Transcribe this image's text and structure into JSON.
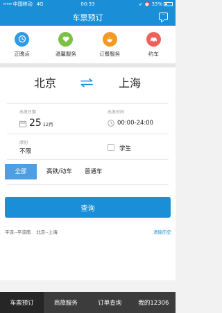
{
  "status": {
    "signal_dots": "•••••",
    "carrier": "中国移动",
    "network": "4G",
    "time": "00:33",
    "battery": "33%"
  },
  "nav": {
    "title": "车票预订"
  },
  "services": [
    {
      "label": "正晚点",
      "color": "#2d9be8",
      "icon": "clock-icon"
    },
    {
      "label": "温馨服务",
      "color": "#7cc242",
      "icon": "heart-icon"
    },
    {
      "label": "订餐服务",
      "color": "#f29a25",
      "icon": "meal-icon"
    },
    {
      "label": "约车",
      "color": "#f0605a",
      "icon": "car-icon"
    }
  ],
  "cities": {
    "from": "北京",
    "to": "上海"
  },
  "date": {
    "label": "出发日期",
    "day": "25",
    "month": "12月"
  },
  "time": {
    "label": "出发时间",
    "value": "00:00-24:00"
  },
  "seat": {
    "label": "席别",
    "value": "不限"
  },
  "student": {
    "label": "学生"
  },
  "tabs": [
    "全部",
    "高铁/动车",
    "普通车"
  ],
  "query": {
    "label": "查询"
  },
  "history": {
    "items": [
      "平凉--平凉南",
      "北京--上海"
    ],
    "clear": "清除历史"
  },
  "bottom_tabs": [
    "车票预订",
    "商旅服务",
    "订单查询",
    "我的12306"
  ]
}
